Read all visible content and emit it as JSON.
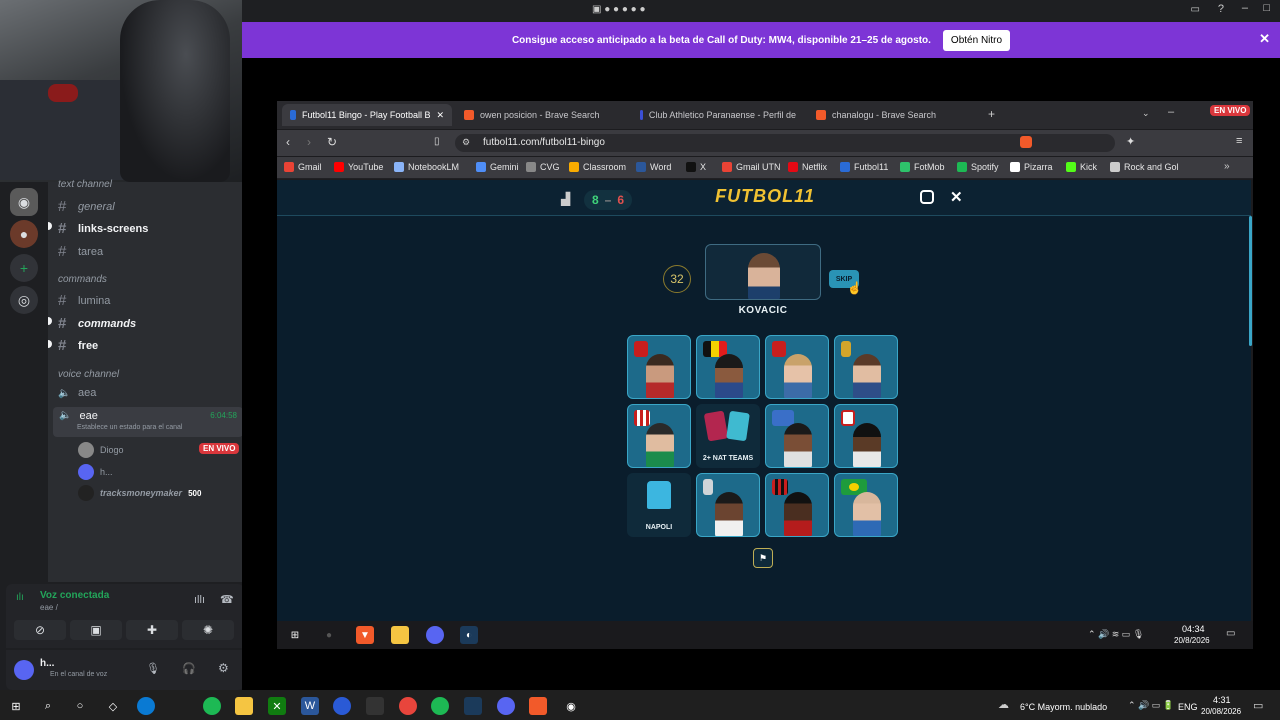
{
  "discord": {
    "categories": {
      "text": "text channel",
      "commands": "commands",
      "voice": "voice channel"
    },
    "channels": {
      "general": "general",
      "links": "links-screens",
      "tarea": "tarea",
      "lumina": "lumina",
      "commands": "commands",
      "free": "free",
      "aea": "aea",
      "eae": "eae"
    },
    "eae_timer": "6:04:58",
    "eae_status": "Establece un estado para el canal",
    "voice_users": [
      {
        "name": "Diogo",
        "badge": "EN VIVO"
      },
      {
        "name": "h..."
      },
      {
        "name": "tracksmoneymaker",
        "badge": "500"
      }
    ],
    "voice_connected": "Voz conectada",
    "voice_sub": "eae /",
    "user_name": "h...",
    "user_status": "En el canal de voz"
  },
  "nitro": {
    "text": "Consigue acceso anticipado a la beta de Call of Duty: MW4, disponible 21–25 de agosto.",
    "button": "Obtén Nitro"
  },
  "browser": {
    "tabs": [
      {
        "title": "Futbol11 Bingo - Play Football B",
        "color": "#2a6bd6"
      },
      {
        "title": "owen posicion - Brave Search",
        "color": "#f25a2a"
      },
      {
        "title": "Club Athletico Paranaense - Perfil de",
        "color": "#3b4fd6"
      },
      {
        "title": "chanalogu - Brave Search",
        "color": "#f25a2a"
      }
    ],
    "live_badge": "EN VIVO",
    "url": "futbol11.com/futbol11-bingo",
    "bookmarks": [
      {
        "label": "Gmail",
        "color": "#ea4335"
      },
      {
        "label": "YouTube",
        "color": "#ff0000"
      },
      {
        "label": "NotebookLM",
        "color": "#8ab4f8"
      },
      {
        "label": "Gemini",
        "color": "#4f8ef7"
      },
      {
        "label": "CVG",
        "color": "#888888"
      },
      {
        "label": "Classroom",
        "color": "#f9ab00"
      },
      {
        "label": "Word",
        "color": "#2b579a"
      },
      {
        "label": "X",
        "color": "#111111"
      },
      {
        "label": "Gmail UTN",
        "color": "#ea4335"
      },
      {
        "label": "Netflix",
        "color": "#e50914"
      },
      {
        "label": "Futbol11",
        "color": "#2a6bd6"
      },
      {
        "label": "FotMob",
        "color": "#2ec36b"
      },
      {
        "label": "Spotify",
        "color": "#1db954"
      },
      {
        "label": "Pizarra",
        "color": "#ffffff"
      },
      {
        "label": "Kick",
        "color": "#53fc18"
      },
      {
        "label": "Rock and Gol",
        "color": "#cccccc"
      }
    ]
  },
  "game": {
    "score_left": "8",
    "score_sep": "–",
    "score_right": "6",
    "logo": "FUTBOL11",
    "counter": "32",
    "player_name": "KOVACIC",
    "skip": "SKIP",
    "cell_labels": {
      "nat_teams": "2+ NAT TEAMS",
      "napoli": "NAPOLI"
    }
  },
  "inner_taskbar": {
    "time": "04:34",
    "date": "20/8/2026"
  },
  "taskbar": {
    "weather": "6°C  Mayorm. nublado",
    "lang": "ENG",
    "time": "4:31",
    "date": "20/08/2026"
  }
}
